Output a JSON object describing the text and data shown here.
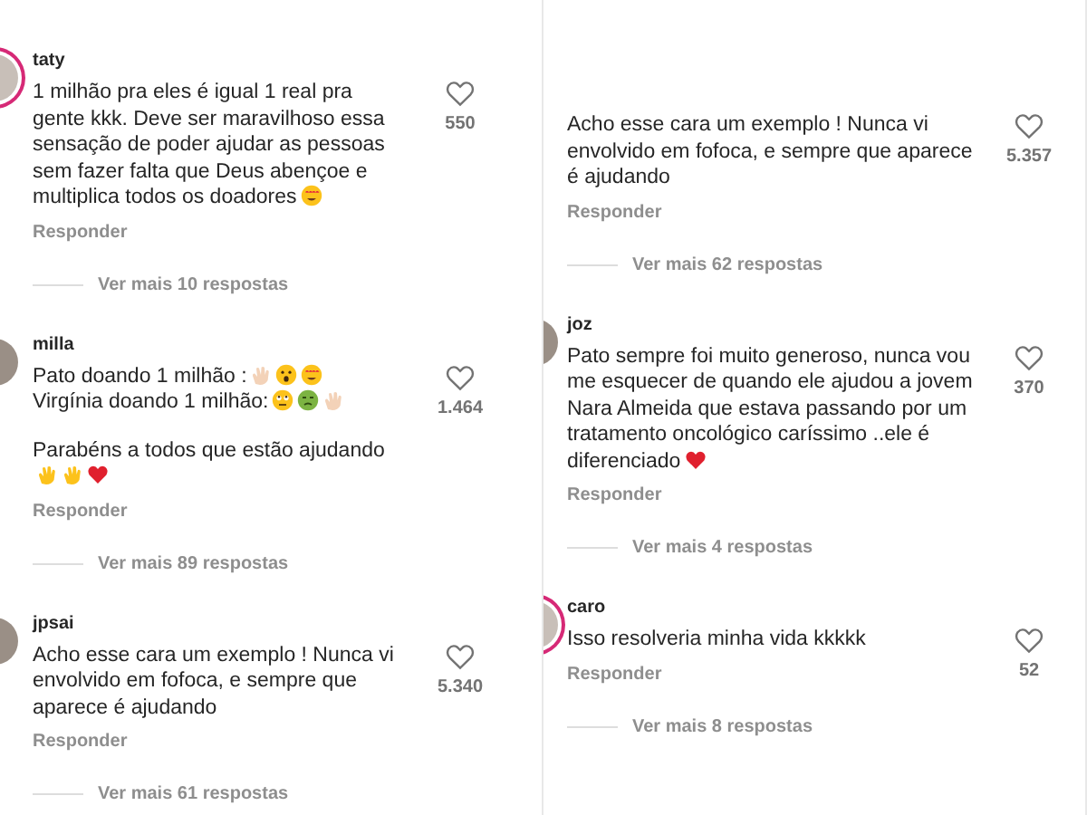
{
  "panels": [
    {
      "comments": [
        {
          "username": "taty",
          "story_ring": true,
          "paragraphs": [
            {
              "text": "1 milhão pra eles é igual 1 real pra gente kkk. Deve ser maravilhoso essa sensação de poder ajudar as pessoas sem fazer falta que Deus abençoe e multiplica todos os doadores",
              "emoji": [
                {
                  "kind": "hearteyes"
                }
              ]
            }
          ],
          "likes": "550",
          "reply": "Responder",
          "more_replies": "Ver mais 10 respostas"
        },
        {
          "username": "milla",
          "story_ring": false,
          "paragraphs": [
            {
              "text": "Pato doando 1 milhão :",
              "emoji": [
                {
                  "kind": "clap"
                },
                {
                  "kind": "surprised"
                },
                {
                  "kind": "hearteyes"
                }
              ]
            },
            {
              "text": "Virgínia doando 1 milhão:",
              "emoji": [
                {
                  "kind": "eyeroll"
                },
                {
                  "kind": "nauseated"
                },
                {
                  "kind": "clap"
                }
              ]
            },
            {
              "text": "Parabéns a todos que estão ajudando",
              "emoji": [
                {
                  "kind": "clapyellow"
                },
                {
                  "kind": "clapyellow"
                },
                {
                  "kind": "heart"
                }
              ]
            }
          ],
          "likes": "1.464",
          "reply": "Responder",
          "more_replies": "Ver mais 89 respostas"
        },
        {
          "username": "jpsai",
          "story_ring": false,
          "paragraphs": [
            {
              "text": "Acho esse cara um exemplo ! Nunca vi envolvido em fofoca, e sempre que aparece é ajudando"
            }
          ],
          "likes": "5.340",
          "reply": "Responder",
          "more_replies": "Ver mais 61 respostas"
        }
      ]
    },
    {
      "comments": [
        {
          "paragraphs": [
            {
              "text": "Acho esse cara um exemplo ! Nunca vi envolvido em fofoca, e sempre que aparece é ajudando"
            }
          ],
          "likes": "5.357",
          "reply": "Responder",
          "more_replies": "Ver mais 62 respostas"
        },
        {
          "username": "joz",
          "story_ring": false,
          "paragraphs": [
            {
              "text": "Pato sempre foi muito generoso, nunca vou me esquecer de quando ele ajudou a jovem Nara Almeida que estava passando por um tratamento oncológico caríssimo ..ele é diferenciado",
              "emoji": [
                {
                  "kind": "heart"
                }
              ]
            }
          ],
          "likes": "370",
          "reply": "Responder",
          "more_replies": "Ver mais 4 respostas"
        },
        {
          "username": "caro",
          "story_ring": true,
          "paragraphs": [
            {
              "text": "Isso resolveria minha vida kkkkk"
            }
          ],
          "likes": "52",
          "reply": "Responder",
          "more_replies": "Ver mais 8 respostas"
        }
      ]
    }
  ]
}
